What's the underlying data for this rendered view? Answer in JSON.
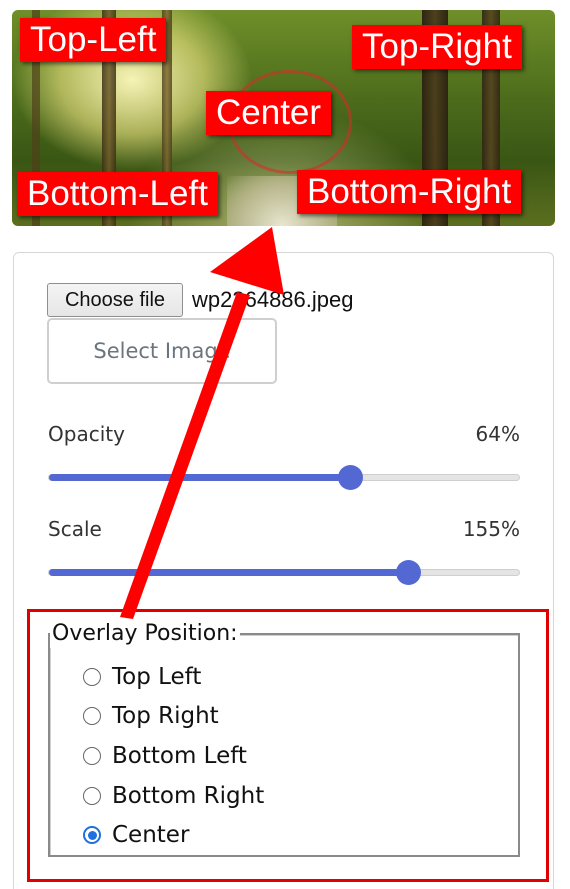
{
  "preview": {
    "overlay_labels": {
      "top_left": "Top-Left",
      "top_right": "Top-Right",
      "center": "Center",
      "bottom_left": "Bottom-Left",
      "bottom_right": "Bottom-Right"
    }
  },
  "file_input": {
    "button_label": "Choose file",
    "file_name": "wp2364886.jpeg"
  },
  "select_image_button": "Select Image",
  "opacity": {
    "label": "Opacity",
    "value_text": "64%",
    "value": 64,
    "max": 100
  },
  "scale": {
    "label": "Scale",
    "value_text": "155%",
    "value": 155,
    "min": 10,
    "max": 200
  },
  "overlay_position": {
    "legend": "Overlay Position:",
    "options": [
      {
        "label": "Top Left",
        "checked": false
      },
      {
        "label": "Top Right",
        "checked": false
      },
      {
        "label": "Bottom Left",
        "checked": false
      },
      {
        "label": "Bottom Right",
        "checked": false
      },
      {
        "label": "Center",
        "checked": true
      }
    ]
  },
  "colors": {
    "accent": "#5468d4",
    "annotation_red": "#e10000",
    "radio_checked": "#1f6fe0"
  }
}
